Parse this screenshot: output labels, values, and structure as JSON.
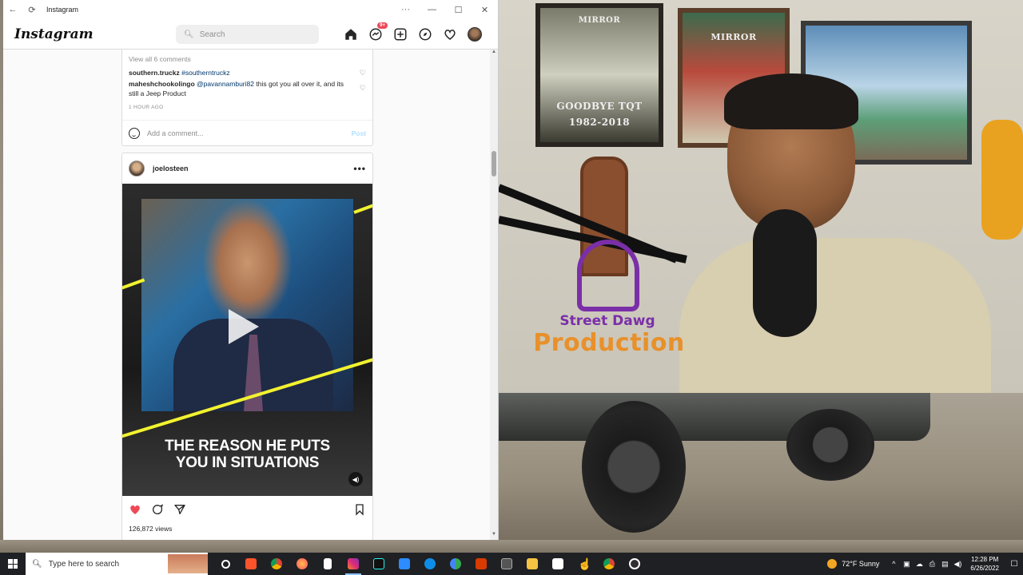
{
  "window": {
    "title": "Instagram"
  },
  "nav": {
    "logo": "Instagram",
    "search_placeholder": "Search",
    "messenger_badge": "9+"
  },
  "post1": {
    "view_comments": "View all 6 comments",
    "comment1_user": "southern.truckz",
    "comment1_text": "#southerntruckz",
    "comment2_user": "maheshchookolingo",
    "comment2_mention": "@pavannamburi82",
    "comment2_text": "this got you all over it, and its still a Jeep Product",
    "timestamp": "1 HOUR AGO",
    "add_comment_placeholder": "Add a comment...",
    "post_label": "Post"
  },
  "post2": {
    "username": "joelosteen",
    "more": "•••",
    "caption_line1": "THE REASON HE PUTS",
    "caption_line2": "YOU IN SITUATIONS",
    "views": "126,872 views"
  },
  "webcam": {
    "poster1_top": "MIRROR",
    "poster1_line1": "GOODBYE TQT",
    "poster1_line2": "1982-2018",
    "poster2_top": "MIRROR",
    "watermark_line1": "Street Dawg",
    "watermark_line2": "Production"
  },
  "taskbar": {
    "search_placeholder": "Type here to search",
    "weather": "72°F  Sunny",
    "time": "12:28 PM",
    "date": "6/26/2022"
  },
  "colors": {
    "ig_blue_link": "#00376b",
    "like_red": "#ed4956",
    "caption_yellow": "#f2f230",
    "watermark_purple": "#7a2fa8",
    "watermark_orange": "#e8902a"
  }
}
